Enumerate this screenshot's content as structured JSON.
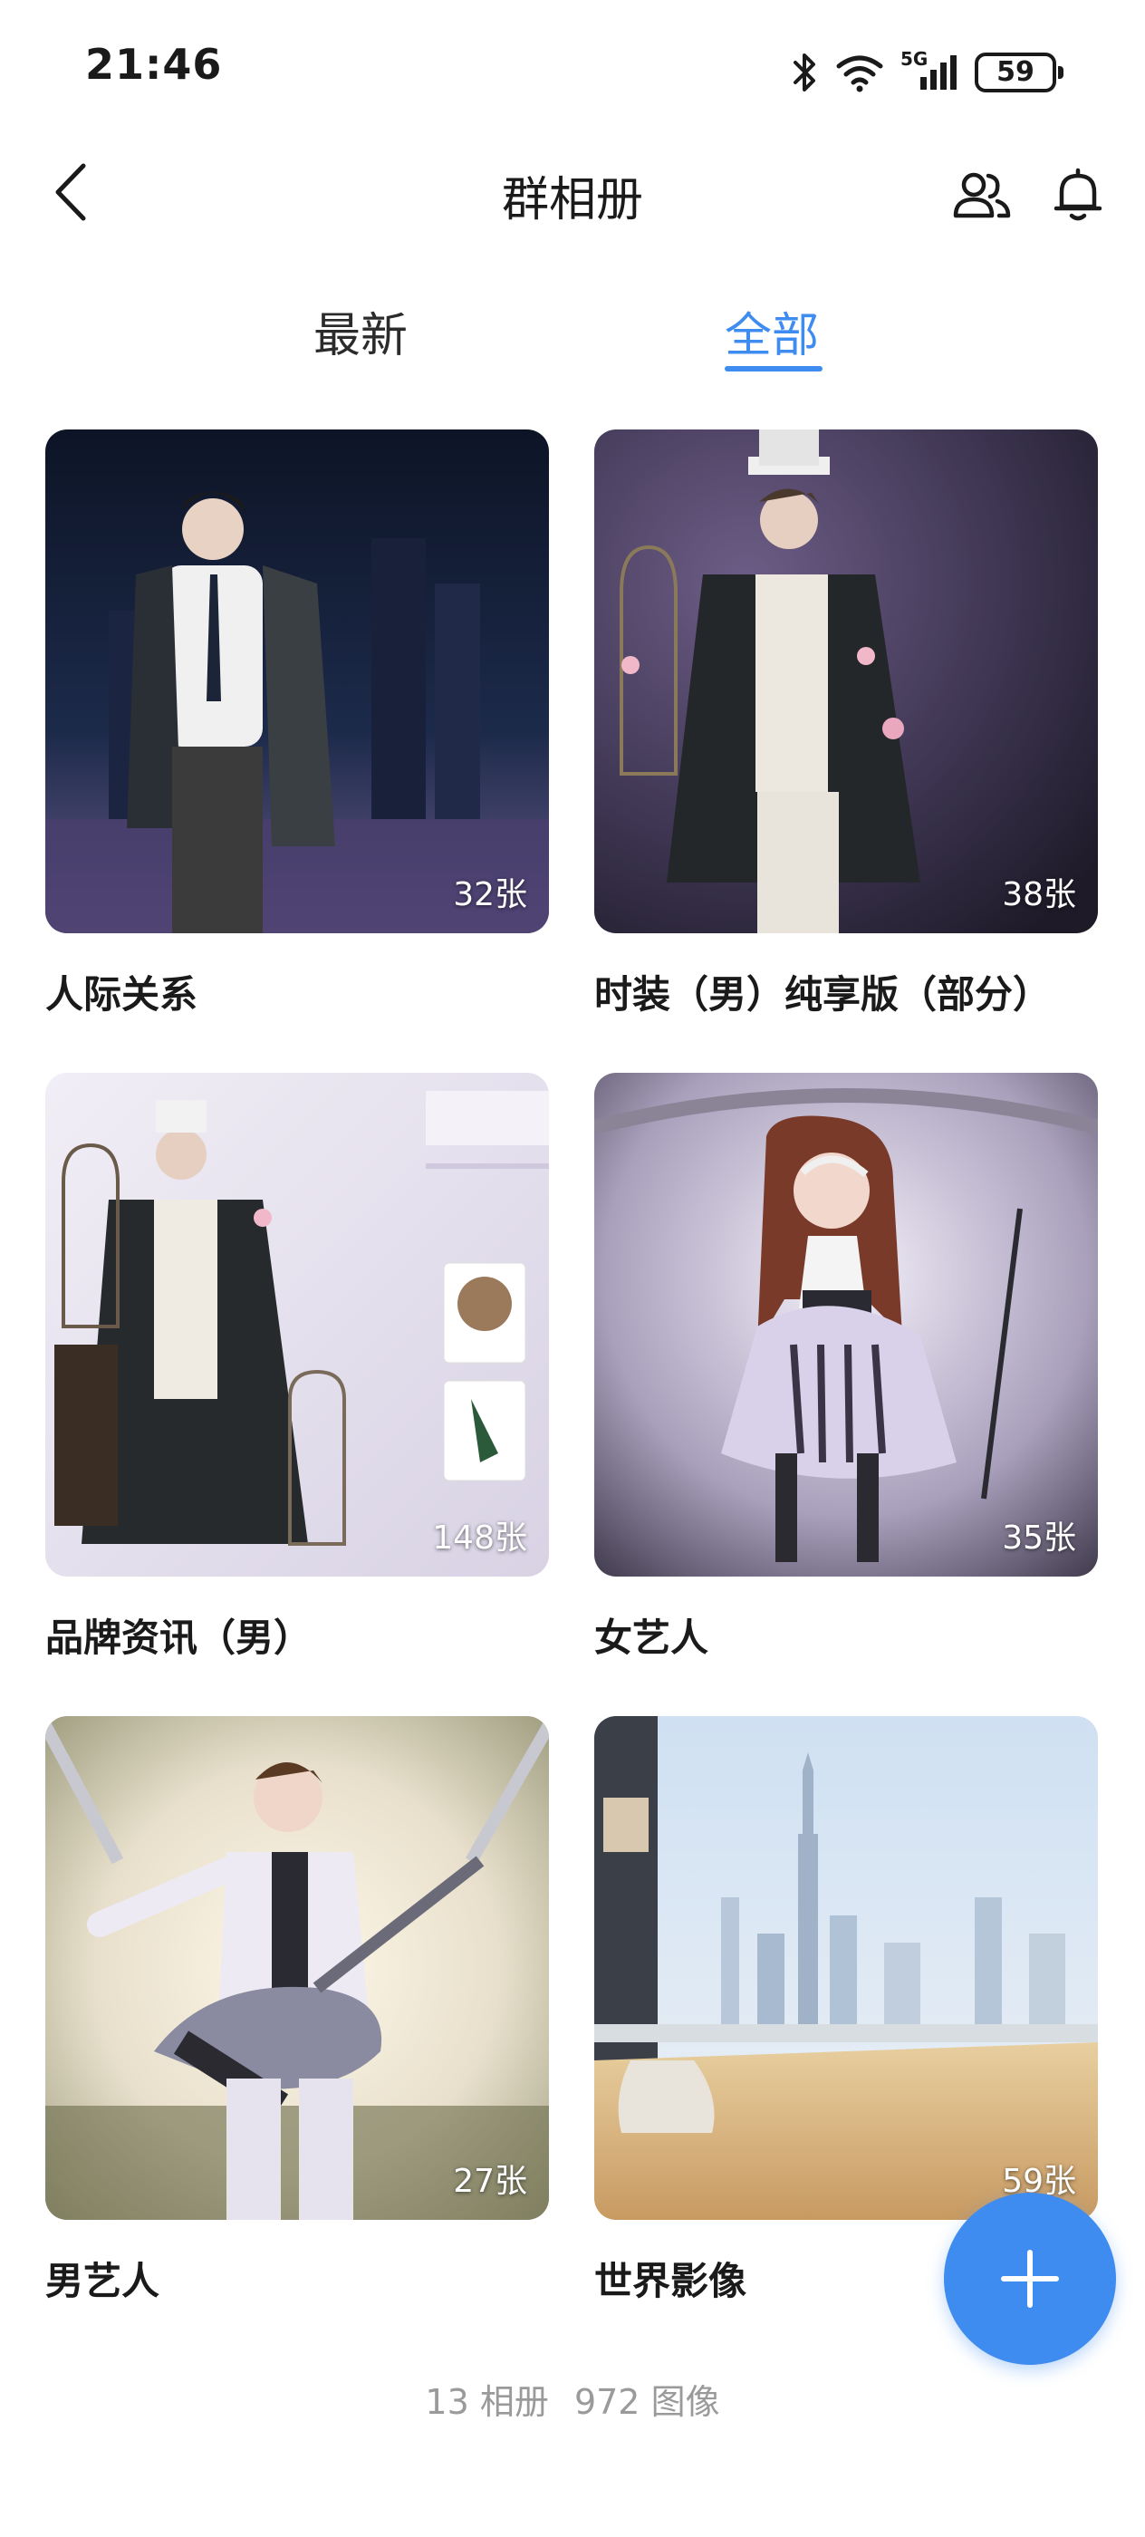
{
  "status_bar": {
    "time": "21:46",
    "network": "5G",
    "battery": "59",
    "icons": [
      "bluetooth-icon",
      "wifi-icon",
      "signal-icon",
      "battery-icon"
    ]
  },
  "header": {
    "title": "群相册",
    "icons": [
      "back-arrow-icon",
      "members-icon",
      "bell-icon"
    ]
  },
  "tabs": [
    {
      "label": "最新",
      "active": false
    },
    {
      "label": "全部",
      "active": true
    }
  ],
  "accent_color": "#3f8cf0",
  "albums": [
    {
      "title": "人际关系",
      "count": "32张"
    },
    {
      "title": "时装（男）纯享版（部分）",
      "count": "38张"
    },
    {
      "title": "品牌资讯（男）",
      "count": "148张"
    },
    {
      "title": "女艺人",
      "count": "35张"
    },
    {
      "title": "男艺人",
      "count": "27张"
    },
    {
      "title": "世界影像",
      "count": "59张"
    }
  ],
  "footer": {
    "albums": "13 相册",
    "images": "972 图像"
  },
  "fab": {
    "icon": "plus-icon"
  }
}
